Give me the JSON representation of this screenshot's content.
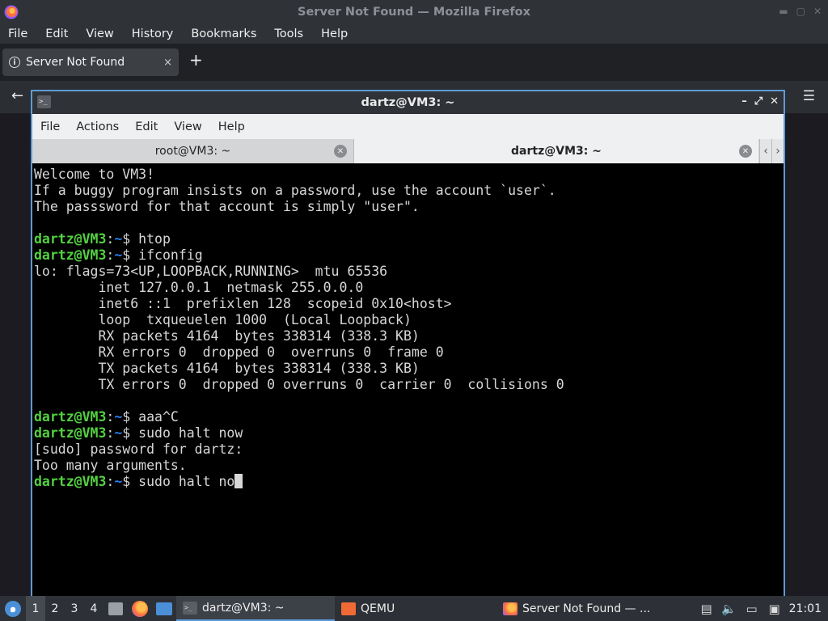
{
  "firefox": {
    "window_title": "Server Not Found — Mozilla Firefox",
    "menu": [
      "File",
      "Edit",
      "View",
      "History",
      "Bookmarks",
      "Tools",
      "Help"
    ],
    "tab_title": "Server Not Found",
    "tab_close": "×",
    "new_tab": "+",
    "back": "←",
    "menu_button": "☰"
  },
  "terminal": {
    "window_title": "dartz@VM3: ~",
    "menu": [
      "File",
      "Actions",
      "Edit",
      "View",
      "Help"
    ],
    "tabs": [
      {
        "label": "root@VM3: ~",
        "active": false
      },
      {
        "label": "dartz@VM3: ~",
        "active": true
      }
    ],
    "prompt": {
      "user": "dartz@VM3",
      "colon": ":",
      "path": "~",
      "symbol": "$ "
    },
    "lines": [
      {
        "type": "text",
        "text": "Welcome to VM3!"
      },
      {
        "type": "text",
        "text": "If a buggy program insists on a password, use the account `user`."
      },
      {
        "type": "text",
        "text": "The passsword for that account is simply \"user\"."
      },
      {
        "type": "text",
        "text": ""
      },
      {
        "type": "prompt",
        "cmd": "htop"
      },
      {
        "type": "prompt",
        "cmd": "ifconfig"
      },
      {
        "type": "text",
        "text": "lo: flags=73<UP,LOOPBACK,RUNNING>  mtu 65536"
      },
      {
        "type": "text",
        "text": "        inet 127.0.0.1  netmask 255.0.0.0"
      },
      {
        "type": "text",
        "text": "        inet6 ::1  prefixlen 128  scopeid 0x10<host>"
      },
      {
        "type": "text",
        "text": "        loop  txqueuelen 1000  (Local Loopback)"
      },
      {
        "type": "text",
        "text": "        RX packets 4164  bytes 338314 (338.3 KB)"
      },
      {
        "type": "text",
        "text": "        RX errors 0  dropped 0  overruns 0  frame 0"
      },
      {
        "type": "text",
        "text": "        TX packets 4164  bytes 338314 (338.3 KB)"
      },
      {
        "type": "text",
        "text": "        TX errors 0  dropped 0 overruns 0  carrier 0  collisions 0"
      },
      {
        "type": "text",
        "text": ""
      },
      {
        "type": "prompt",
        "cmd": "aaa^C"
      },
      {
        "type": "prompt",
        "cmd": "sudo halt now"
      },
      {
        "type": "text",
        "text": "[sudo] password for dartz:"
      },
      {
        "type": "text",
        "text": "Too many arguments."
      },
      {
        "type": "prompt",
        "cmd": "sudo halt no",
        "cursor": true
      }
    ]
  },
  "taskbar": {
    "desktops": [
      "1",
      "2",
      "3",
      "4"
    ],
    "active_desktop": "1",
    "tasks": [
      {
        "label": "dartz@VM3: ~",
        "icon": "terminal-icon",
        "active": true
      },
      {
        "label": "QEMU",
        "icon": "qemu-icon",
        "active": false
      },
      {
        "label": "Server Not Found — ...",
        "icon": "firefox-icon",
        "active": false
      }
    ],
    "clock": "21:01"
  },
  "colors": {
    "prompt_user": "#53d141",
    "prompt_path": "#2a7df0",
    "window_border": "#5e9ad6"
  }
}
